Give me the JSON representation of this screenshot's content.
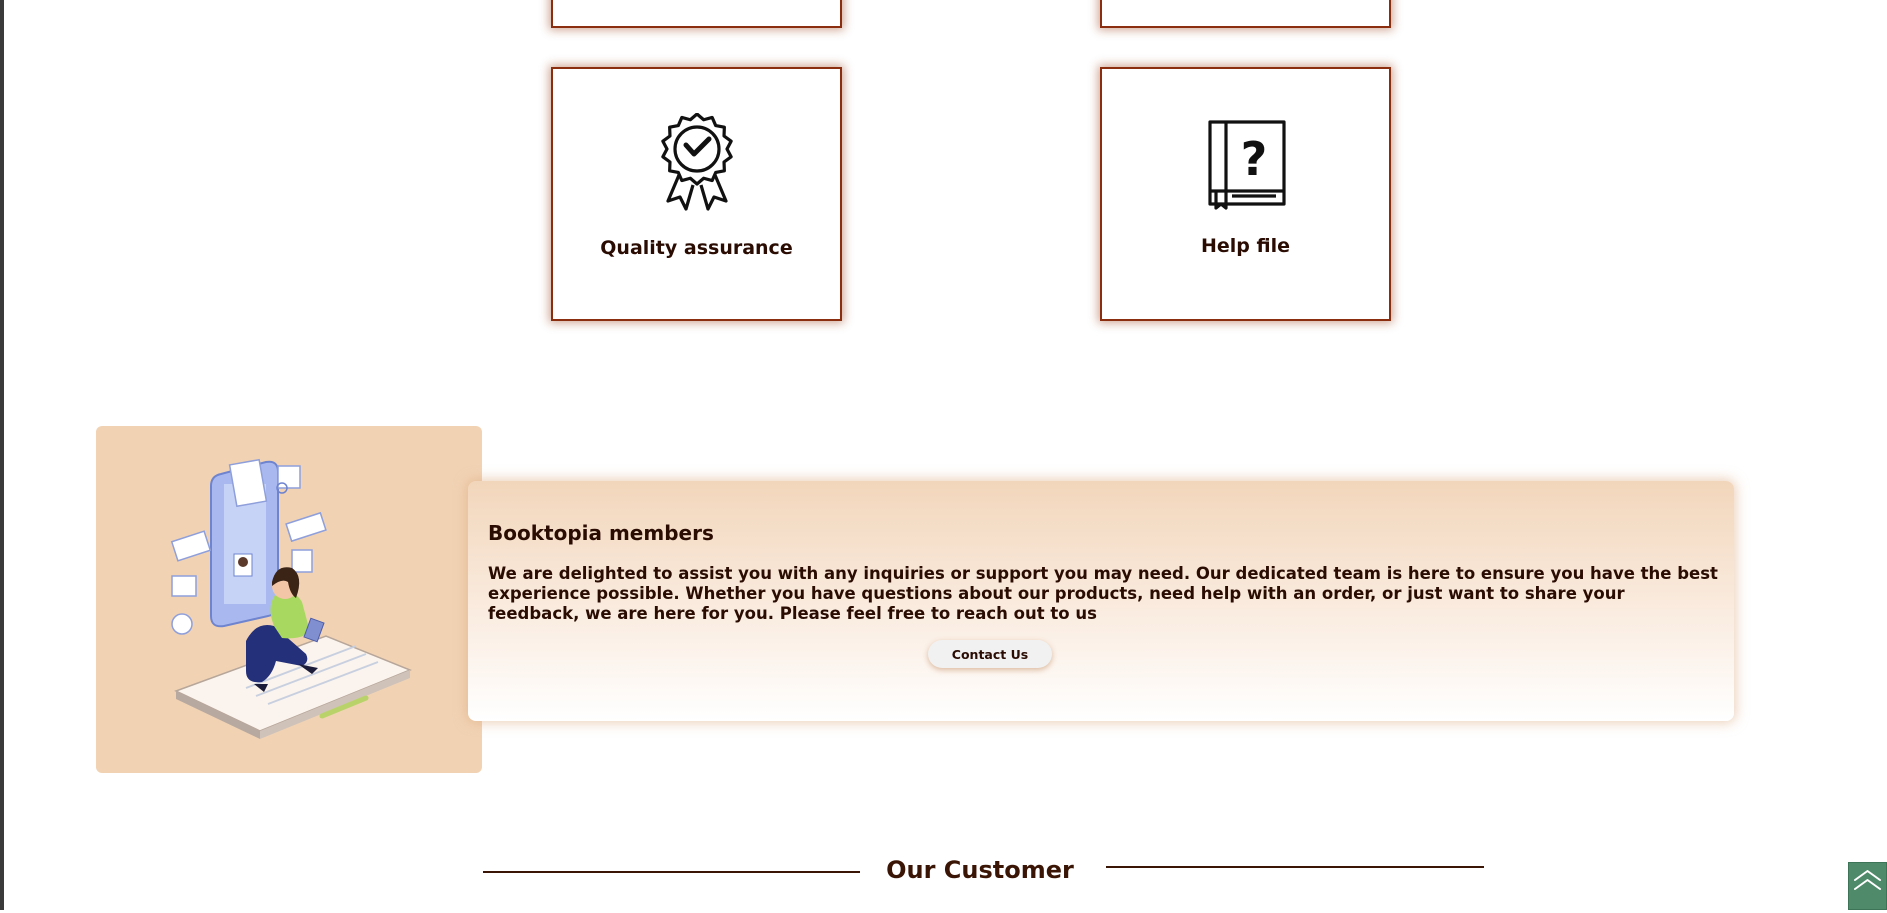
{
  "features": {
    "quality": {
      "label": "Quality assurance",
      "icon": "award-ribbon-icon"
    },
    "help": {
      "label": "Help file",
      "icon": "help-book-icon"
    }
  },
  "members": {
    "title": "Booktopia members",
    "description": "We are delighted to assist you with any inquiries or support you may need. Our dedicated team is here to ensure you have the best experience possible. Whether you have questions about our products, need help with an order, or just want to share your feedback, we are here for you. Please feel free to reach out to us",
    "contact_label": "Contact Us"
  },
  "customers": {
    "heading": "Our Customer"
  },
  "scroll_top": {
    "icon": "double-chevron-up-icon"
  },
  "colors": {
    "card_border": "#8b2e10",
    "text": "#2a0c03",
    "panel_bg": "#f1d3b4",
    "scroll_button": "#4f8a6a"
  }
}
